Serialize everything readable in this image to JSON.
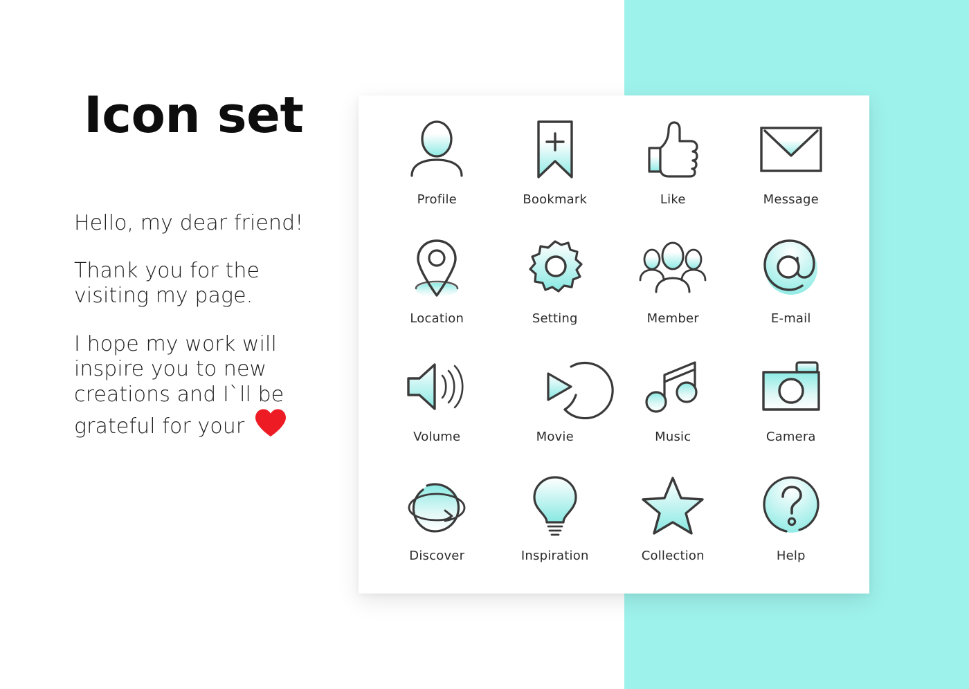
{
  "page": {
    "title": "Icon set",
    "background_color": "#ffffff",
    "accent_panel_color": "#9ef2ec",
    "card_color": "#ffffff",
    "stroke_color": "#3a3a3a",
    "gradient_top_color": "#ffffff",
    "gradient_bottom_color": "#8ceae4",
    "heart_color": "#ed1c24"
  },
  "intro": {
    "greeting": "Hello, my dear friend!",
    "paragraph_1": "Thank you for the visiting my page.",
    "paragraph_2": "I hope my work will inspire you to new creations and I`ll be grateful for your",
    "heart_icon": "heart-icon"
  },
  "icons": [
    {
      "label": "Profile",
      "icon": "profile-icon"
    },
    {
      "label": "Bookmark",
      "icon": "bookmark-add-icon"
    },
    {
      "label": "Like",
      "icon": "thumbs-up-icon"
    },
    {
      "label": "Message",
      "icon": "envelope-icon"
    },
    {
      "label": "Location",
      "icon": "map-pin-icon"
    },
    {
      "label": "Setting",
      "icon": "gear-icon"
    },
    {
      "label": "Member",
      "icon": "people-group-icon"
    },
    {
      "label": "E-mail",
      "icon": "at-sign-icon"
    },
    {
      "label": "Volume",
      "icon": "speaker-volume-icon"
    },
    {
      "label": "Movie",
      "icon": "play-circle-icon"
    },
    {
      "label": "Music",
      "icon": "music-notes-icon"
    },
    {
      "label": "Camera",
      "icon": "camera-icon"
    },
    {
      "label": "Discover",
      "icon": "globe-orbit-icon"
    },
    {
      "label": "Inspiration",
      "icon": "lightbulb-icon"
    },
    {
      "label": "Collection",
      "icon": "star-icon"
    },
    {
      "label": "Help",
      "icon": "question-circle-icon"
    }
  ]
}
